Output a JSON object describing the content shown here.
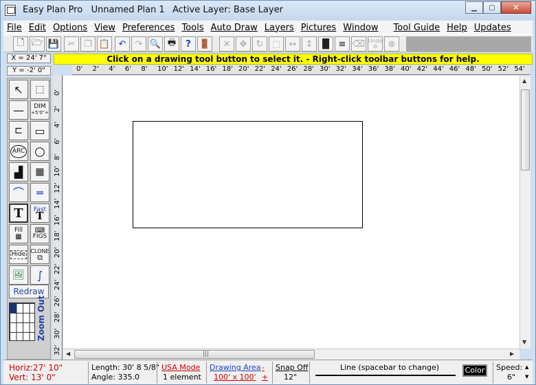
{
  "titlebar": {
    "app_name": "Easy Plan Pro",
    "plan_name": "Unnamed Plan 1",
    "active_layer": "Active Layer: Base Layer"
  },
  "menu": {
    "items": [
      "File",
      "Edit",
      "Options",
      "View",
      "Preferences",
      "Tools",
      "Auto Draw",
      "Layers",
      "Pictures",
      "Window",
      "Tool Guide",
      "Help",
      "Updates"
    ]
  },
  "coords": {
    "x": "X = 24' 7\"",
    "y": "Y = -2' 0\""
  },
  "help_banner": "Click on a drawing tool button to select it.  -  Right-click toolbar buttons for help.",
  "hruler": [
    "0'",
    "2'",
    "4'",
    "6'",
    "8'",
    "10'",
    "12'",
    "14'",
    "16'",
    "18'",
    "20'",
    "22'",
    "24'",
    "26'",
    "28'",
    "30'",
    "32'",
    "34'",
    "36'",
    "38'",
    "40'",
    "42'",
    "44'",
    "46'",
    "48'",
    "50'",
    "52'",
    "54'"
  ],
  "vruler": [
    "0'",
    "2'",
    "4'",
    "6'",
    "8'",
    "10'",
    "12'",
    "14'",
    "16'",
    "18'",
    "20'",
    "22'",
    "24'",
    "26'",
    "28'",
    "30'",
    "32'"
  ],
  "palette": {
    "dim_label": "DIM",
    "dim_sub": "+5'0\"+",
    "arc_label": "ARC",
    "fast_label": "Fast",
    "text_label": "T",
    "fill_label": "Fill",
    "figs_label": "FIGS",
    "hide_label": "Hide",
    "clone_label": "CLONE",
    "redraw": "Redraw",
    "zoom_out": "Zoom Out"
  },
  "toolbar": {
    "undo_label": "Undo"
  },
  "status": {
    "horiz": "Horiz:27' 10\"",
    "vert": "Vert: 13' 0\"",
    "length": "Length: 30' 8 5/8\"",
    "angle": "Angle:  335.0",
    "usa_mode": "USA Mode",
    "elements": "1 element",
    "drawing_area": "Drawing Area",
    "area_size": "100' x 100'",
    "minus": "-",
    "plus": "+",
    "snap": "Snap Off",
    "snap_value": "12\"",
    "line_hint": "Line  (spacebar to change)",
    "color": "Color",
    "speed": "Speed:",
    "speed_value": "6\""
  }
}
